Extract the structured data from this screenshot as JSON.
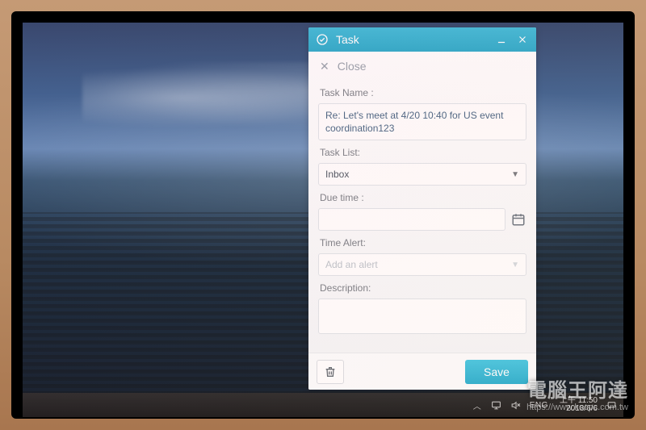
{
  "panel": {
    "title": "Task",
    "close_label": "Close",
    "labels": {
      "task_name": "Task Name :",
      "task_list": "Task List:",
      "due_time": "Due time :",
      "time_alert": "Time Alert:",
      "description": "Description:"
    },
    "fields": {
      "task_name_value": "Re: Let's meet at 4/20 10:40 for US event coordination123",
      "task_list_selected": "Inbox",
      "due_time_value": "",
      "time_alert_placeholder": "Add an alert",
      "description_value": ""
    },
    "buttons": {
      "save": "Save"
    }
  },
  "taskbar": {
    "lang": "ENG",
    "time": "上午 11:50",
    "date": "2018/6/6"
  },
  "watermark": {
    "line1": "電腦王阿達",
    "line2": "https://www.kocpc.com.tw"
  }
}
